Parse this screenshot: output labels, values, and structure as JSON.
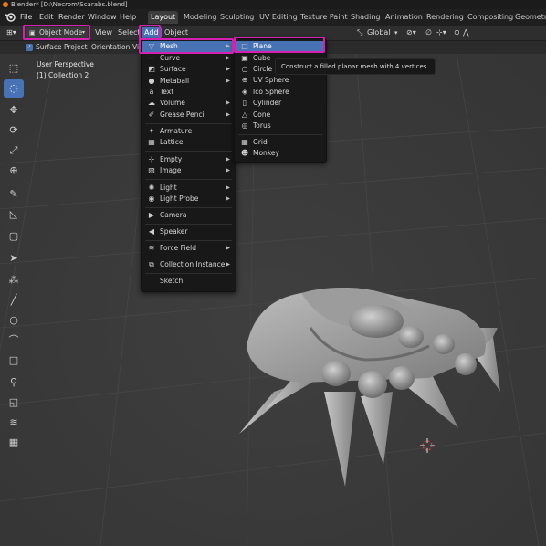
{
  "window_title": "Blender* [D:\\Necrom\\Scarabs.blend]",
  "menubar": [
    "File",
    "Edit",
    "Render",
    "Window",
    "Help"
  ],
  "workspace_tabs": [
    "Layout",
    "Modeling",
    "Sculpting",
    "UV Editing",
    "Texture Paint",
    "Shading",
    "Animation",
    "Rendering",
    "Compositing",
    "Geometry"
  ],
  "active_tab": "Layout",
  "header": {
    "mode": "Object Mode",
    "view": "View",
    "select": "Select",
    "add": "Add",
    "object": "Object",
    "transform_orientation": "Global"
  },
  "tool_options": {
    "surface_project": "Surface Project",
    "orientation_label": "Orientation:",
    "orientation_value": "Vi"
  },
  "viewport": {
    "perspective": "User Perspective",
    "collection": "(1) Collection 2"
  },
  "add_menu": [
    {
      "label": "Mesh",
      "icon": "mesh-icon",
      "submenu": true,
      "active": true
    },
    {
      "label": "Curve",
      "icon": "curve-icon",
      "submenu": true
    },
    {
      "label": "Surface",
      "icon": "surface-icon",
      "submenu": true
    },
    {
      "label": "Metaball",
      "icon": "metaball-icon",
      "submenu": true
    },
    {
      "label": "Text",
      "icon": "text-icon",
      "submenu": false
    },
    {
      "label": "Volume",
      "icon": "volume-icon",
      "submenu": true
    },
    {
      "label": "Grease Pencil",
      "icon": "grease-pencil-icon",
      "submenu": true
    },
    {
      "label": "Armature",
      "icon": "armature-icon",
      "submenu": false
    },
    {
      "label": "Lattice",
      "icon": "lattice-icon",
      "submenu": false
    },
    {
      "label": "Empty",
      "icon": "empty-icon",
      "submenu": true
    },
    {
      "label": "Image",
      "icon": "image-icon",
      "submenu": true
    },
    {
      "label": "Light",
      "icon": "light-icon",
      "submenu": true
    },
    {
      "label": "Light Probe",
      "icon": "light-probe-icon",
      "submenu": true
    },
    {
      "label": "Camera",
      "icon": "camera-icon",
      "submenu": false
    },
    {
      "label": "Speaker",
      "icon": "speaker-icon",
      "submenu": false
    },
    {
      "label": "Force Field",
      "icon": "force-field-icon",
      "submenu": true
    },
    {
      "label": "Collection Instance",
      "icon": "collection-instance-icon",
      "submenu": true
    },
    {
      "label": "Sketch",
      "icon": "",
      "submenu": false
    }
  ],
  "mesh_menu": [
    {
      "label": "Plane",
      "icon": "plane-icon",
      "active": true
    },
    {
      "label": "Cube",
      "icon": "cube-icon"
    },
    {
      "label": "Circle",
      "icon": "circle-icon"
    },
    {
      "label": "UV Sphere",
      "icon": "uv-sphere-icon"
    },
    {
      "label": "Ico Sphere",
      "icon": "ico-sphere-icon"
    },
    {
      "label": "Cylinder",
      "icon": "cylinder-icon"
    },
    {
      "label": "Cone",
      "icon": "cone-icon"
    },
    {
      "label": "Torus",
      "icon": "torus-icon"
    },
    {
      "label": "Grid",
      "icon": "grid-icon"
    },
    {
      "label": "Monkey",
      "icon": "monkey-icon"
    }
  ],
  "tooltip": "Construct a filled planar mesh with 4 vertices.",
  "colors": {
    "accent": "#4772b3",
    "highlight": "#d81fb4",
    "menu_bg": "#181818",
    "viewport_bg": "#3a3a3a"
  }
}
